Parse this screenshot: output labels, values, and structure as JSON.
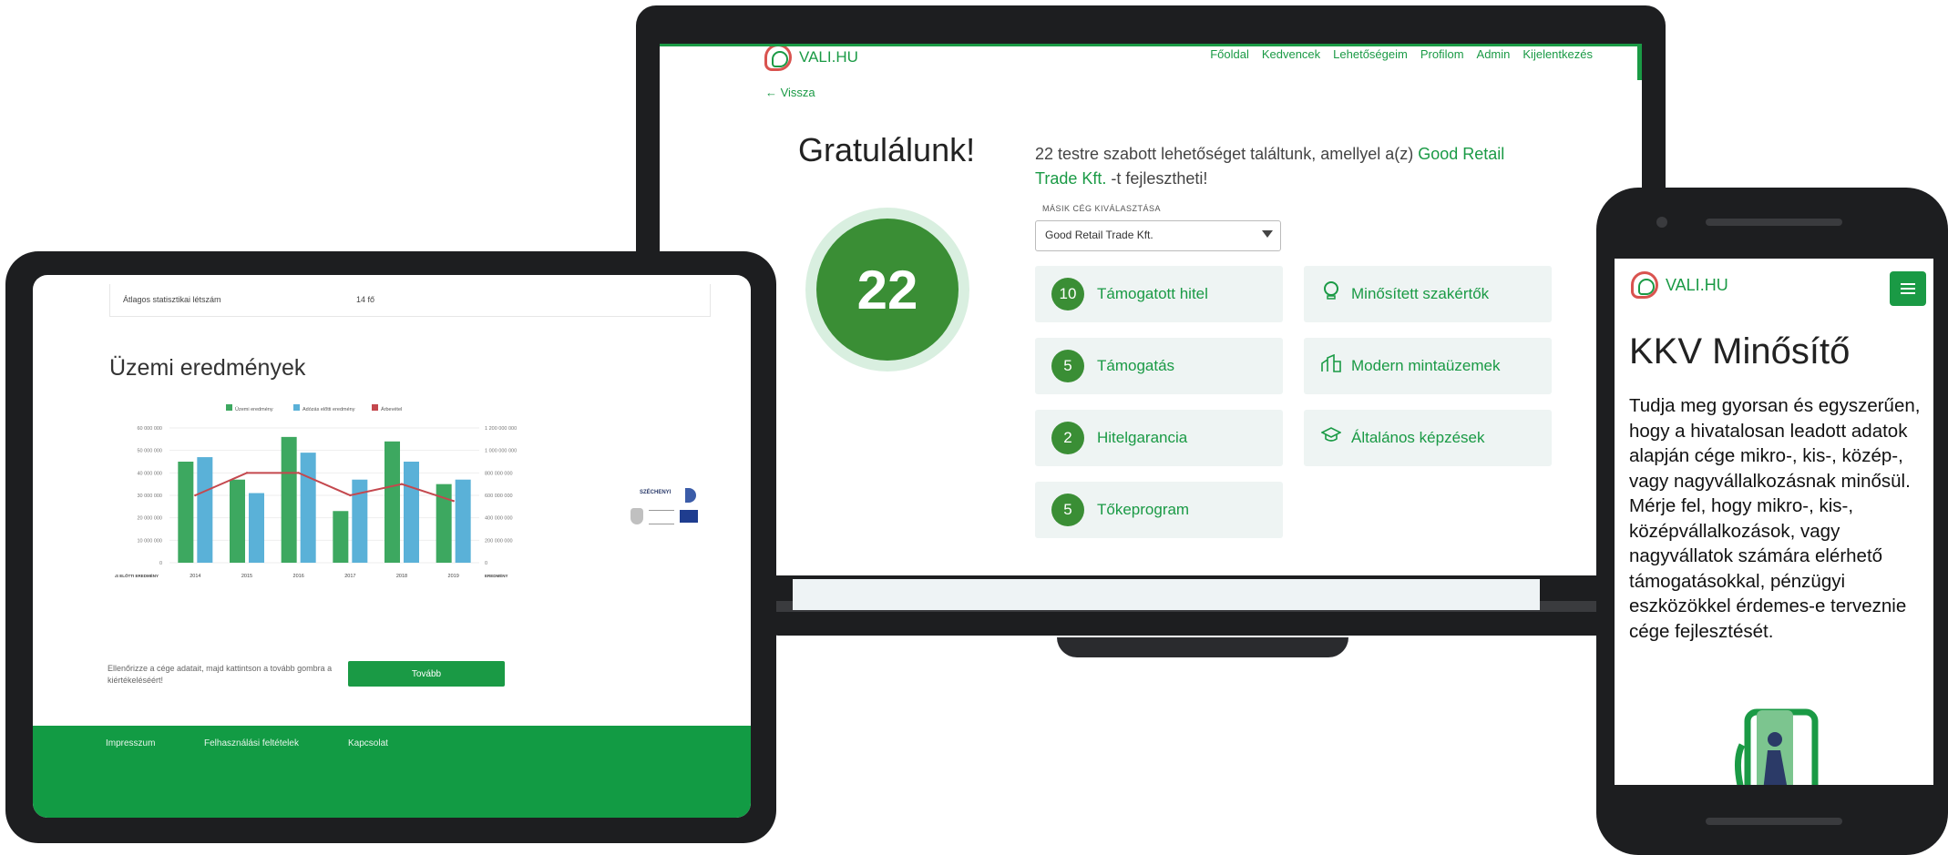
{
  "laptop": {
    "logo_text": "VALI.HU",
    "nav": [
      "Főoldal",
      "Kedvencek",
      "Lehetőségeim",
      "Profilom",
      "Admin",
      "Kijelentkezés"
    ],
    "back_label": "← Vissza",
    "title": "Gratulálunk!",
    "count": "22",
    "message_prefix": "22 testre szabott lehetőséget találtunk, amellyel a(z) ",
    "message_company": "Good Retail Trade Kft.",
    "message_suffix": " -t fejlesztheti!",
    "select_label": "MÁSIK CÉG KIVÁLASZTÁSA",
    "select_value": "Good Retail Trade Kft.",
    "cards_left": [
      {
        "count": "10",
        "label": "Támogatott hitel"
      },
      {
        "count": "5",
        "label": "Támogatás"
      },
      {
        "count": "2",
        "label": "Hitelgarancia"
      },
      {
        "count": "5",
        "label": "Tőkeprogram"
      }
    ],
    "cards_right": [
      {
        "icon": "lightbulb-icon",
        "label": "Minősített szakértők"
      },
      {
        "icon": "building-icon",
        "label": "Modern mintaüzemek"
      },
      {
        "icon": "graduation-cap-icon",
        "label": "Általános képzések"
      }
    ]
  },
  "tablet": {
    "stat_label": "Átlagos statisztikai létszám",
    "stat_value": "14 fő",
    "section_title": "Üzemi eredmények",
    "note": "Ellenőrizze a cége adatait, majd kattintson a tovább gombra a kiértékeléséért!",
    "button_label": "Tovább",
    "footer_links": [
      "Impresszum",
      "Felhasználási feltételek",
      "Kapcsolat"
    ],
    "seal_text": "SZÉCHENYI"
  },
  "chart_data": {
    "type": "bar",
    "categories": [
      "2014",
      "2015",
      "2016",
      "2017",
      "2018",
      "2019"
    ],
    "x_left_label": "ADÓZÁS ELŐTTI EREDMÉNY",
    "x_right_label": "EREDMÉNY",
    "legend": [
      "Üzemi eredmény",
      "Adózás előtti eredmény",
      "Árbevétel"
    ],
    "series": [
      {
        "name": "Üzemi eredmény",
        "color": "#3da860",
        "values": [
          45000000,
          37000000,
          56000000,
          23000000,
          54000000,
          35000000
        ]
      },
      {
        "name": "Adózás előtti eredmény",
        "color": "#5ab1d8",
        "values": [
          47000000,
          31000000,
          49000000,
          37000000,
          45000000,
          37000000
        ]
      },
      {
        "name": "Árbevétel",
        "color": "#c4484e",
        "type": "line",
        "values": [
          600000000,
          800000000,
          800000000,
          600000000,
          700000000,
          550000000
        ]
      }
    ],
    "y_left_ticks": [
      "60 000 000",
      "50 000 000",
      "40 000 000",
      "30 000 000",
      "20 000 000",
      "10 000 000",
      "0"
    ],
    "y_right_ticks": [
      "1 200 000 000",
      "1 000 000 000",
      "800 000 000",
      "600 000 000",
      "400 000 000",
      "200 000 000",
      "0"
    ],
    "ylim_left": [
      0,
      60000000
    ],
    "ylim_right": [
      0,
      1200000000
    ]
  },
  "phone": {
    "logo_text": "VALI.HU",
    "title": "KKV Minősítő",
    "body": "Tudja meg gyorsan és egyszerűen, hogy a hivatalosan leadott adatok alapján cége mikro-, kis-, közép-, vagy nagyvállalkozásnak minősül. Mérje fel, hogy mikro-, kis-, középvállalkozások, vagy nagyvállatok számára elérhető támogatásokkal, pénzügyi eszközökkel érdemes-e terveznie cége fejlesztését."
  },
  "colors": {
    "brand_green": "#1a9a45",
    "badge_green": "#3a8e35",
    "card_bg": "#eef4f3"
  }
}
